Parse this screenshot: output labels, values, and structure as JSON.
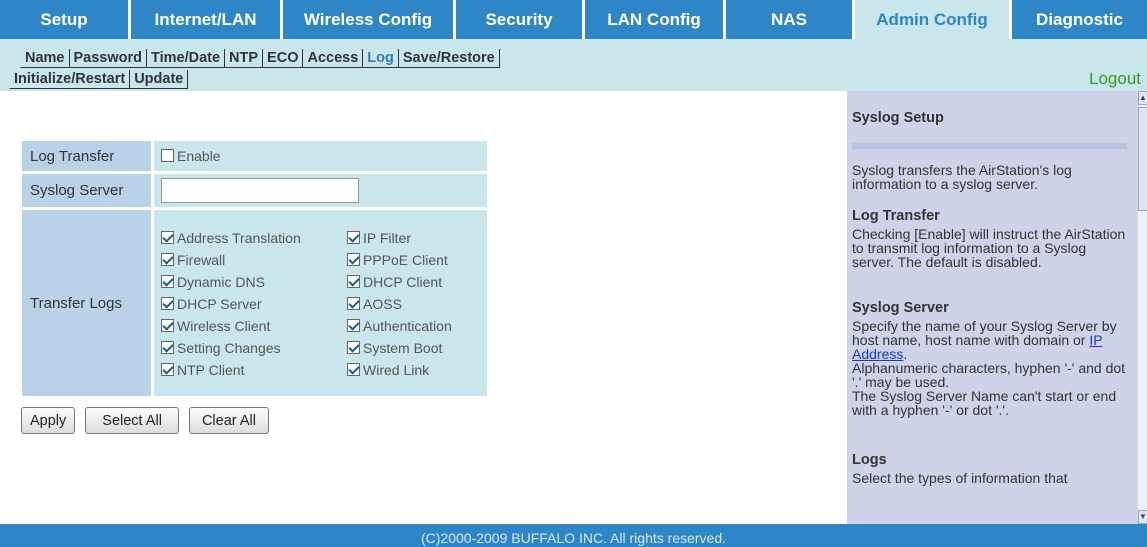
{
  "nav": {
    "tabs": [
      {
        "label": "Setup"
      },
      {
        "label": "Internet/LAN"
      },
      {
        "label": "Wireless Config"
      },
      {
        "label": "Security"
      },
      {
        "label": "LAN Config"
      },
      {
        "label": "NAS"
      },
      {
        "label": "Admin Config",
        "active": true
      },
      {
        "label": "Diagnostic"
      }
    ]
  },
  "subnav": {
    "row1": [
      "Name",
      "Password",
      "Time/Date",
      "NTP",
      "ECO",
      "Access",
      "Log",
      "Save/Restore"
    ],
    "row2": [
      "Initialize/Restart",
      "Update"
    ],
    "active": "Log",
    "logout": "Logout"
  },
  "form": {
    "log_transfer_label": "Log Transfer",
    "enable_label": "Enable",
    "enable_checked": false,
    "syslog_server_label": "Syslog Server",
    "syslog_server_value": "",
    "transfer_logs_label": "Transfer Logs",
    "options": [
      {
        "label": "Address Translation",
        "checked": true
      },
      {
        "label": "IP Filter",
        "checked": true
      },
      {
        "label": "Firewall",
        "checked": true
      },
      {
        "label": "PPPoE Client",
        "checked": true
      },
      {
        "label": "Dynamic DNS",
        "checked": true
      },
      {
        "label": "DHCP Client",
        "checked": true
      },
      {
        "label": "DHCP Server",
        "checked": true
      },
      {
        "label": "AOSS",
        "checked": true
      },
      {
        "label": "Wireless Client",
        "checked": true
      },
      {
        "label": "Authentication",
        "checked": true
      },
      {
        "label": "Setting Changes",
        "checked": true
      },
      {
        "label": "System Boot",
        "checked": true
      },
      {
        "label": "NTP Client",
        "checked": true
      },
      {
        "label": "Wired Link",
        "checked": true
      }
    ]
  },
  "buttons": {
    "apply": "Apply",
    "select_all": "Select All",
    "clear_all": "Clear All"
  },
  "help": {
    "title": "Syslog Setup",
    "intro": "Syslog transfers the AirStation's log information to a syslog server.",
    "log_transfer_title": "Log Transfer",
    "log_transfer_text": "Checking [Enable] will instruct the AirStation to transmit log information to a Syslog server. The default is disabled.",
    "syslog_server_title": "Syslog Server",
    "syslog_server_text_1": "Specify the name of your Syslog Server by host name, host name with domain or",
    "syslog_server_link": "IP Address",
    "syslog_server_text_2": ".",
    "syslog_server_text_3": "Alphanumeric characters, hyphen '-' and dot '.' may be used.",
    "syslog_server_text_4": "The Syslog Server Name can't start or end with a hyphen '-' or dot '.'.",
    "logs_title": "Logs",
    "logs_text": "Select the types of information that"
  },
  "footer": {
    "text": "(C)2000-2009 BUFFALO INC. All rights reserved."
  }
}
